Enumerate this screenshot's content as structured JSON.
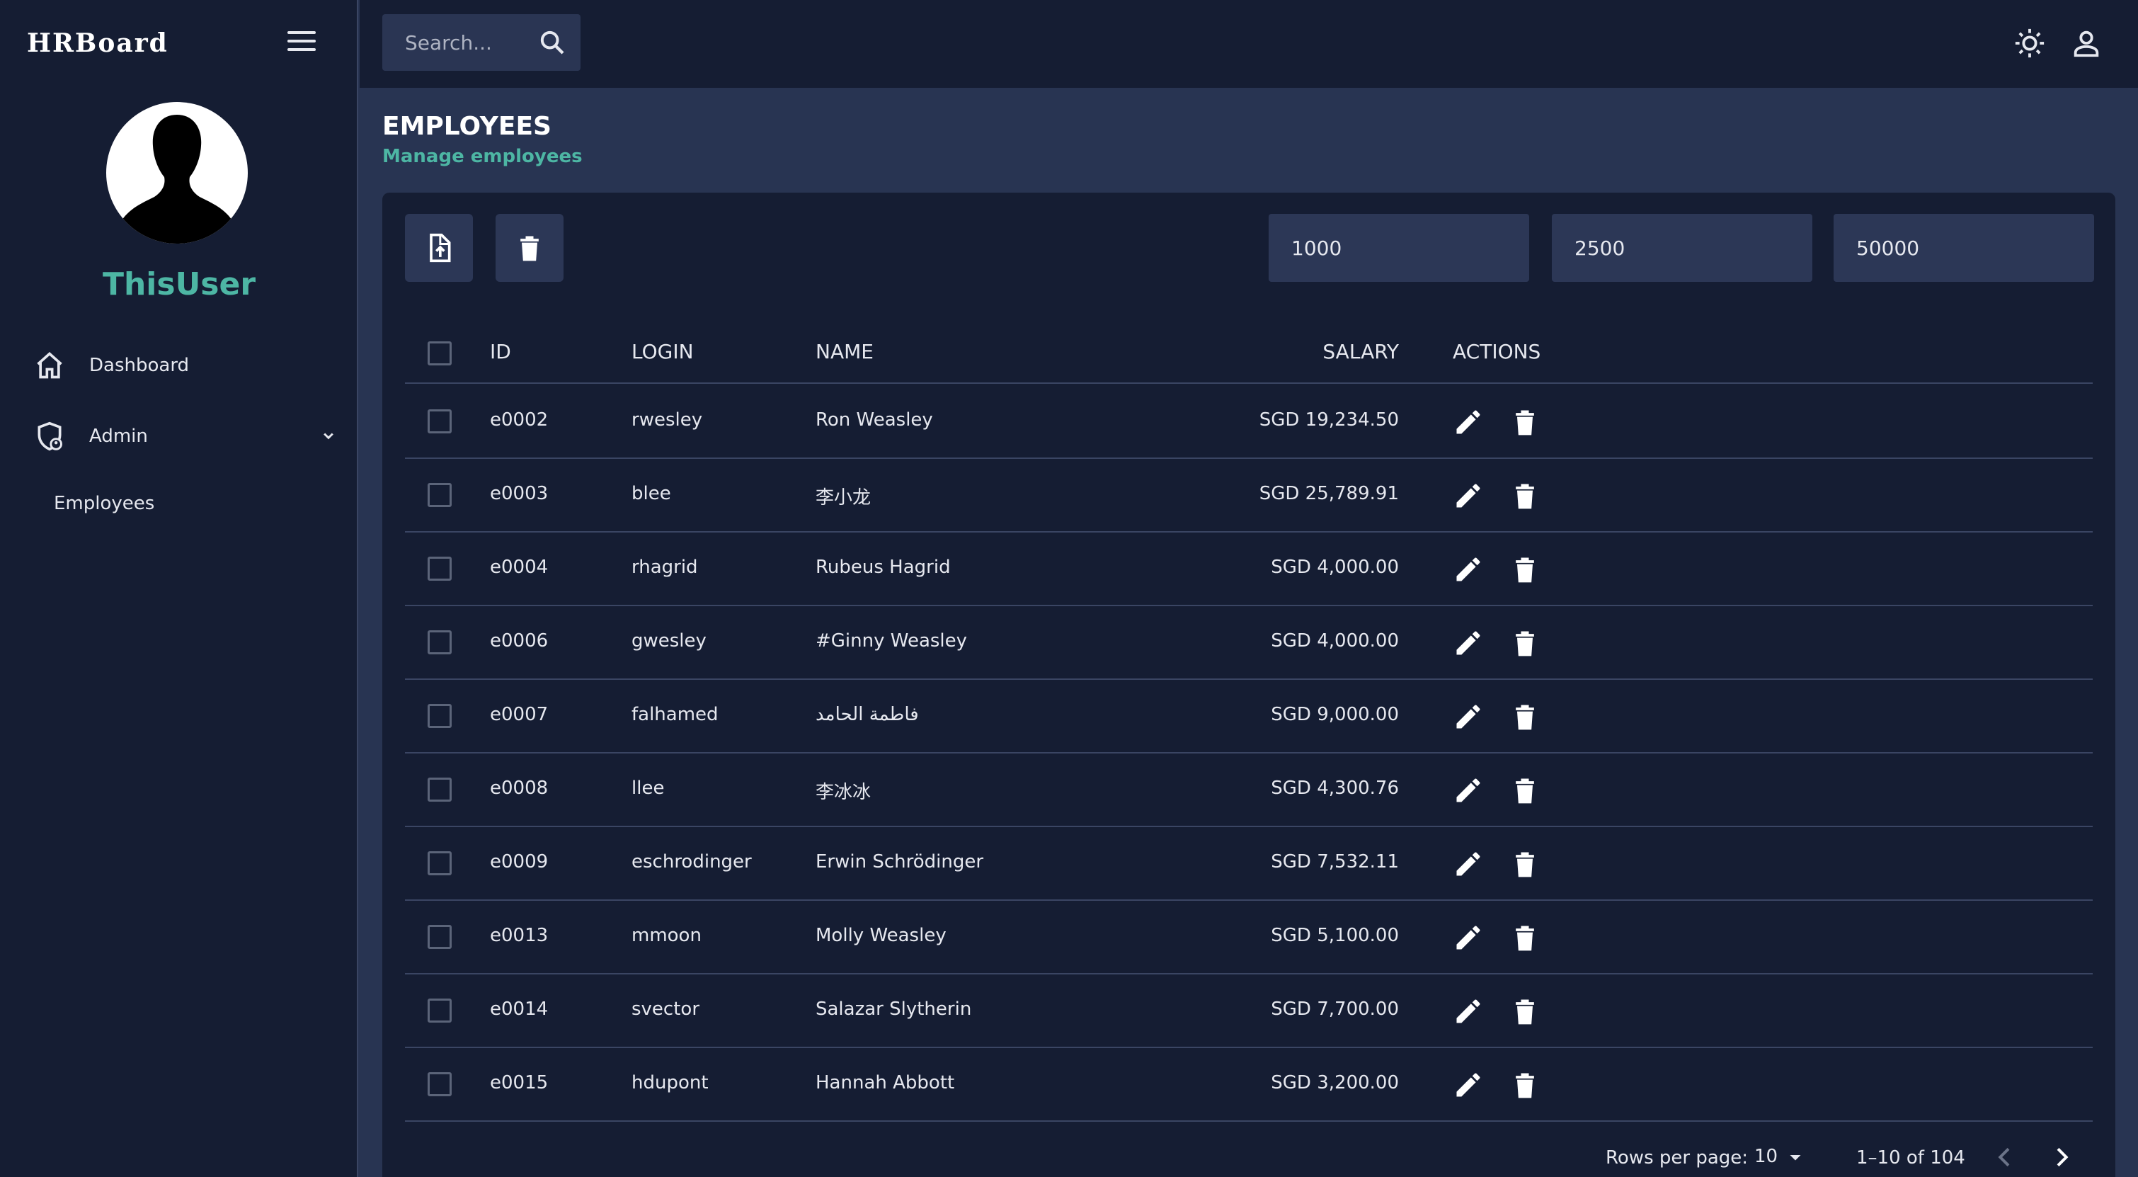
{
  "brand": "HRBoard",
  "user": {
    "name": "ThisUser"
  },
  "sidebar": {
    "items": [
      {
        "label": "Dashboard"
      },
      {
        "label": "Admin"
      }
    ],
    "sub_items": [
      {
        "label": "Employees"
      }
    ]
  },
  "search": {
    "placeholder": "Search..."
  },
  "page": {
    "title": "EMPLOYEES",
    "subtitle": "Manage employees"
  },
  "filters": [
    {
      "value": "1000"
    },
    {
      "value": "2500"
    },
    {
      "value": "50000"
    }
  ],
  "table": {
    "headers": {
      "id": "ID",
      "login": "LOGIN",
      "name": "NAME",
      "salary": "SALARY",
      "actions": "ACTIONS"
    },
    "rows": [
      {
        "id": "e0002",
        "login": "rwesley",
        "name": "Ron Weasley",
        "salary": "SGD 19,234.50"
      },
      {
        "id": "e0003",
        "login": "blee",
        "name": "李小龙",
        "salary": "SGD 25,789.91"
      },
      {
        "id": "e0004",
        "login": "rhagrid",
        "name": "Rubeus Hagrid",
        "salary": "SGD 4,000.00"
      },
      {
        "id": "e0006",
        "login": "gwesley",
        "name": "#Ginny Weasley",
        "salary": "SGD 4,000.00"
      },
      {
        "id": "e0007",
        "login": "falhamed",
        "name": "فاطمة الحامد",
        "salary": "SGD 9,000.00"
      },
      {
        "id": "e0008",
        "login": "llee",
        "name": "李冰冰",
        "salary": "SGD 4,300.76"
      },
      {
        "id": "e0009",
        "login": "eschrodinger",
        "name": "Erwin Schrödinger",
        "salary": "SGD 7,532.11"
      },
      {
        "id": "e0013",
        "login": "mmoon",
        "name": "Molly Weasley",
        "salary": "SGD 5,100.00"
      },
      {
        "id": "e0014",
        "login": "svector",
        "name": "Salazar Slytherin",
        "salary": "SGD 7,700.00"
      },
      {
        "id": "e0015",
        "login": "hdupont",
        "name": "Hannah Abbott",
        "salary": "SGD 3,200.00"
      }
    ]
  },
  "pagination": {
    "rows_per_page_label": "Rows per page:",
    "rows_per_page": "10",
    "range": "1–10 of 104"
  },
  "colors": {
    "accent": "#4db6a4",
    "sidebar": "#151d33",
    "content": "#283452"
  }
}
